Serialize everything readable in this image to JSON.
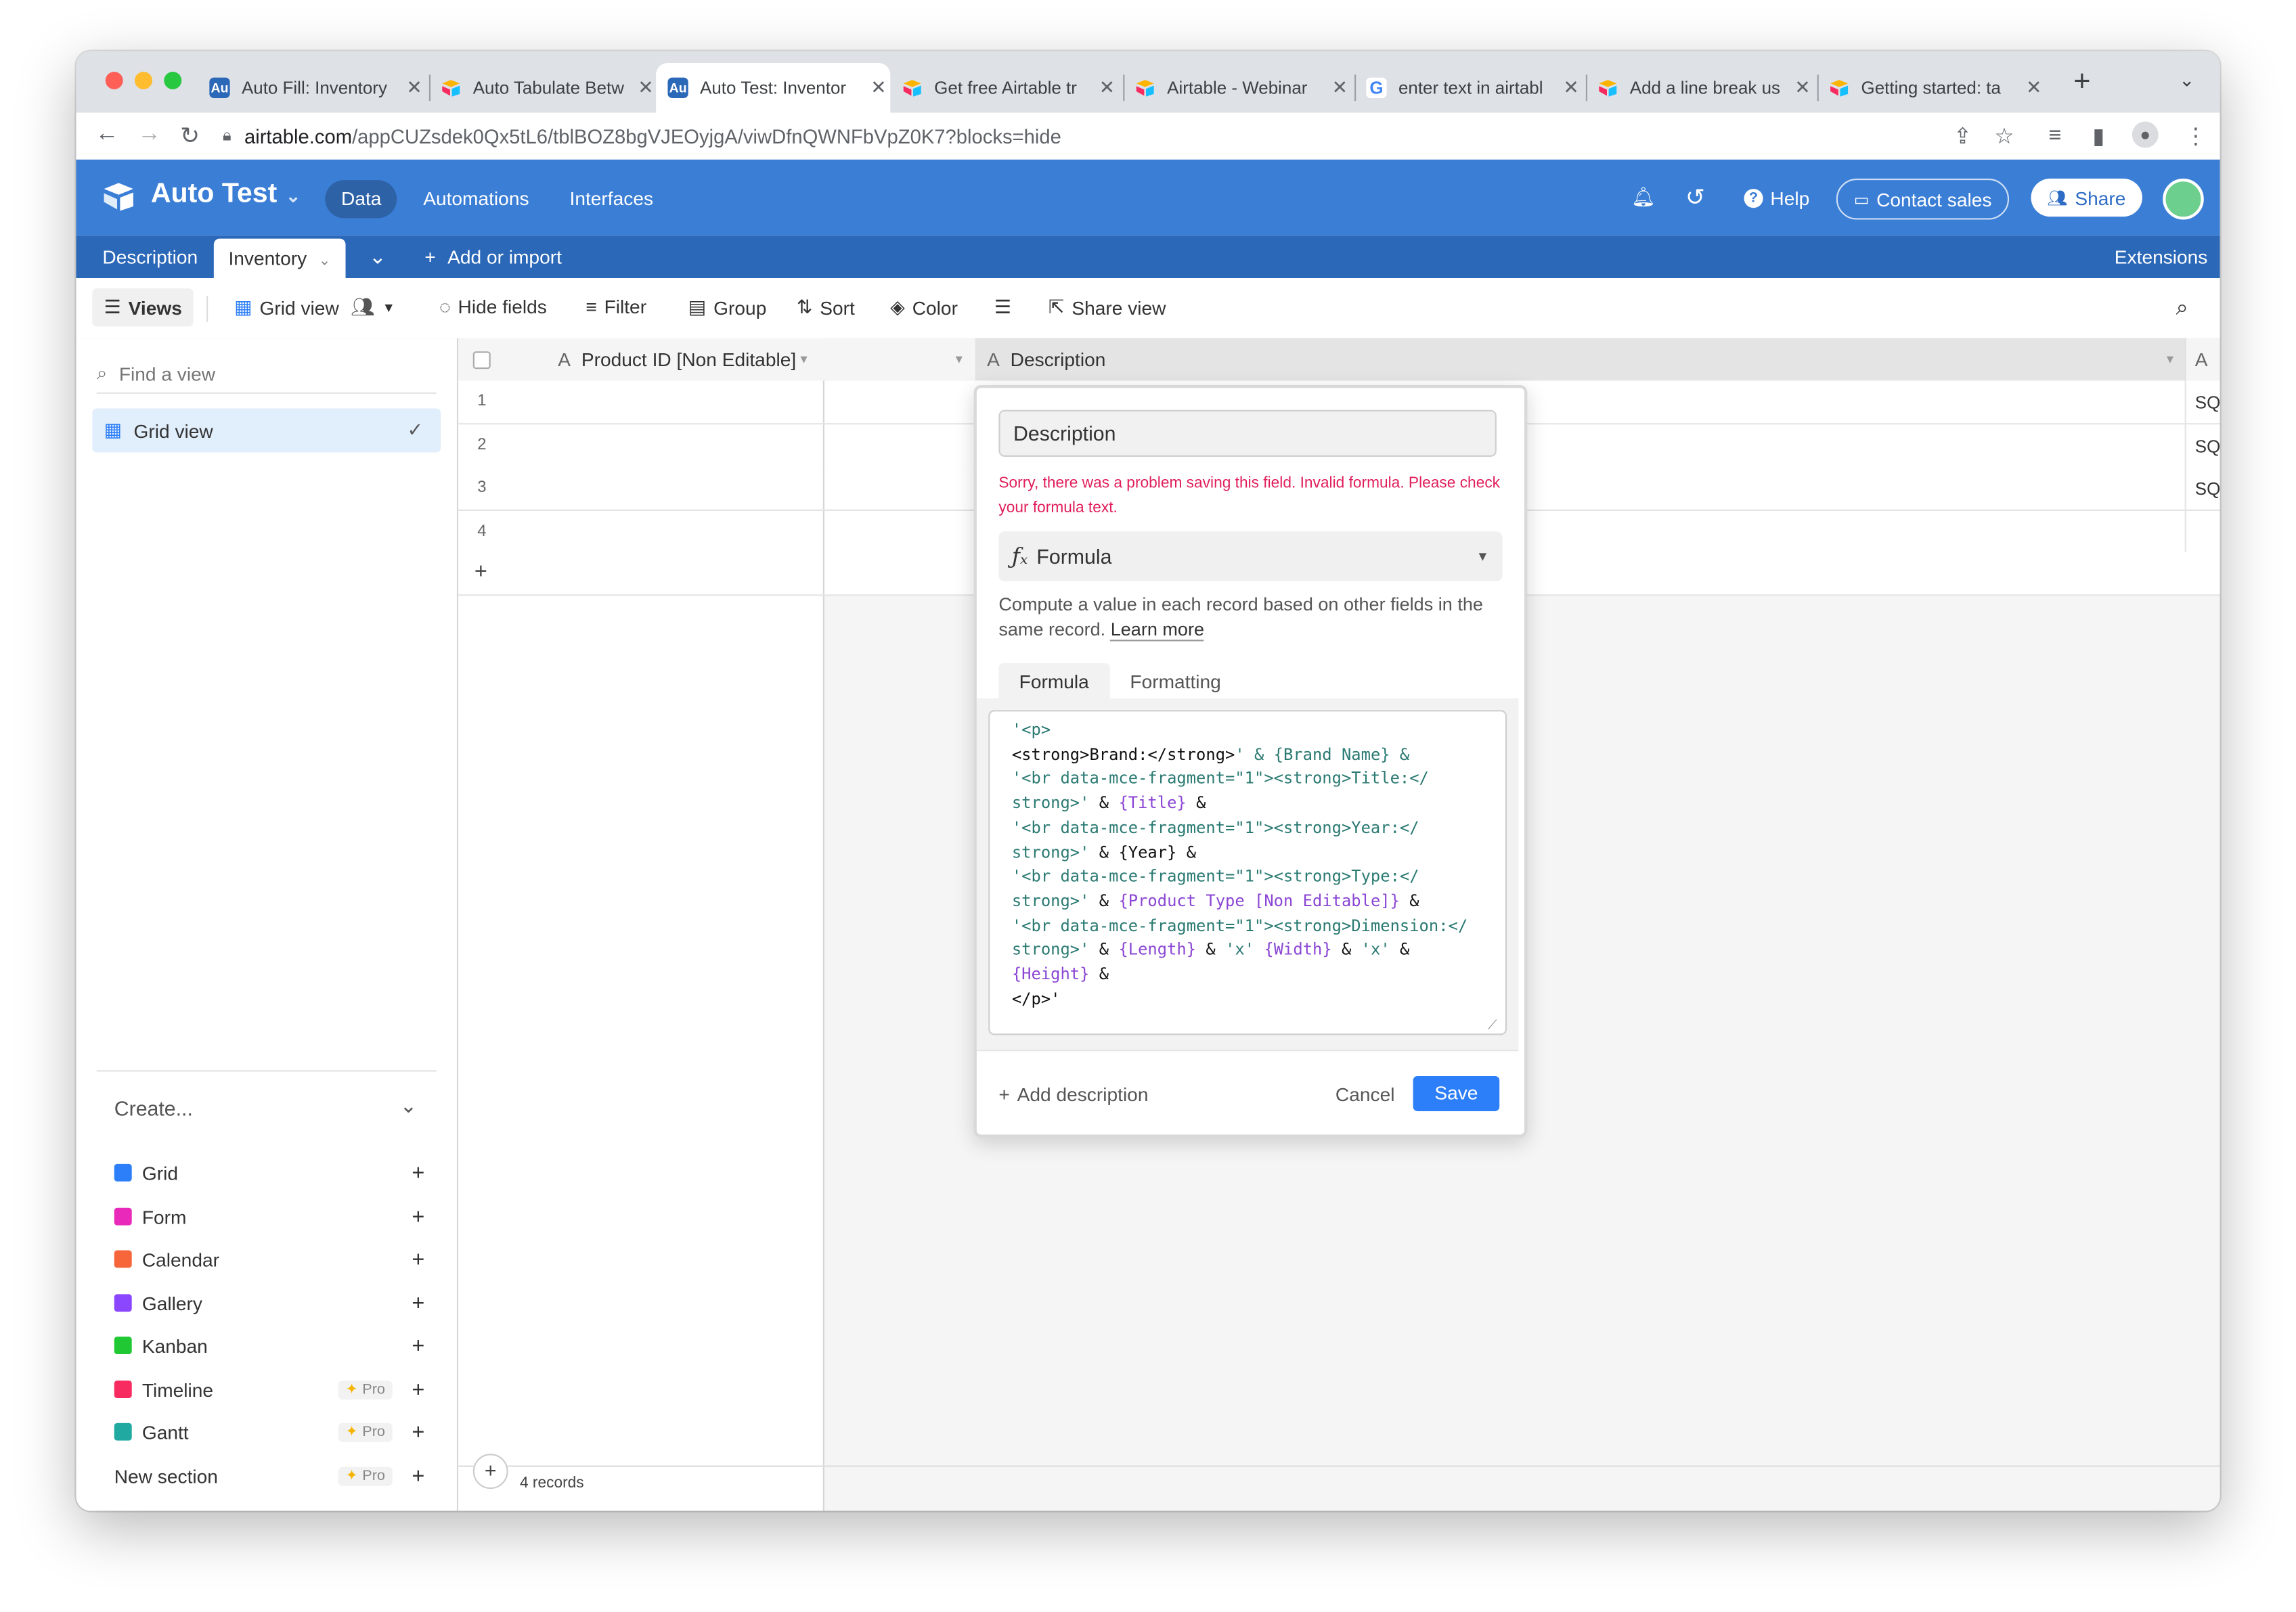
{
  "browser": {
    "tabs": [
      {
        "title": "Auto Fill: Inventory",
        "favicon": "Au"
      },
      {
        "title": "Auto Tabulate Betw",
        "favicon": "airtable"
      },
      {
        "title": "Auto Test: Inventor",
        "favicon": "Au",
        "active": true
      },
      {
        "title": "Get free Airtable tr",
        "favicon": "airtable"
      },
      {
        "title": "Airtable - Webinar",
        "favicon": "airtable"
      },
      {
        "title": "enter text in airtabl",
        "favicon": "G"
      },
      {
        "title": "Add a line break us",
        "favicon": "airtable"
      },
      {
        "title": "Getting started: ta",
        "favicon": "airtable"
      }
    ],
    "url_domain": "airtable.com",
    "url_path": "/appCUZsdek0Qx5tL6/tblBOZ8bgVJEOyjgA/viwDfnQWNFbVpZ0K7?blocks=hide"
  },
  "header": {
    "base_name": "Auto Test",
    "nav": [
      "Data",
      "Automations",
      "Interfaces"
    ],
    "help": "Help",
    "contact_sales": "Contact sales",
    "share": "Share"
  },
  "tables": {
    "items": [
      "Description",
      "Inventory"
    ],
    "add_or_import": "Add or import",
    "extensions": "Extensions"
  },
  "toolbar": {
    "views": "Views",
    "grid_view": "Grid view",
    "hide_fields": "Hide fields",
    "filter": "Filter",
    "group": "Group",
    "sort": "Sort",
    "color": "Color",
    "share_view": "Share view"
  },
  "sidebar": {
    "find_placeholder": "Find a view",
    "active_view": "Grid view",
    "create_label": "Create...",
    "create_items": [
      {
        "label": "Grid",
        "color": "#2d7ff9"
      },
      {
        "label": "Form",
        "color": "#e929ba"
      },
      {
        "label": "Calendar",
        "color": "#f7653b"
      },
      {
        "label": "Gallery",
        "color": "#8b46ff"
      },
      {
        "label": "Kanban",
        "color": "#20c933"
      },
      {
        "label": "Timeline",
        "color": "#f82b60",
        "badge": "Pro"
      },
      {
        "label": "Gantt",
        "color": "#20a9a0",
        "badge": "Pro"
      },
      {
        "label": "New section",
        "badge": "Pro"
      }
    ]
  },
  "grid": {
    "columns": [
      "Product ID [Non Editable]",
      "",
      "Description"
    ],
    "rows": [
      "1",
      "2",
      "3",
      "4"
    ],
    "right_cell_text": "SQ",
    "record_count": "4 records"
  },
  "field_editor": {
    "field_name": "Description",
    "error": "Sorry, there was a problem saving this field. Invalid formula. Please check your formula text.",
    "field_type": "Formula",
    "type_description": "Compute a value in each record based on other fields in the same record.",
    "learn_more": "Learn more",
    "tabs": [
      "Formula",
      "Formatting"
    ],
    "formula_lines": [
      [
        {
          "t": "s",
          "v": "'<p>"
        }
      ],
      [
        {
          "t": "n",
          "v": "<strong>Brand:</strong>"
        },
        {
          "t": "s",
          "v": "' & {Brand Name} &"
        }
      ],
      [
        {
          "t": "s",
          "v": "'<br data-mce-fragment=\"1\"><strong>Title:</"
        }
      ],
      [
        {
          "t": "s",
          "v": "strong>'"
        },
        {
          "t": "n",
          "v": " & "
        },
        {
          "t": "f",
          "v": "{Title}"
        },
        {
          "t": "n",
          "v": " &"
        }
      ],
      [
        {
          "t": "s",
          "v": "'<br data-mce-fragment=\"1\"><strong>Year:</"
        }
      ],
      [
        {
          "t": "s",
          "v": "strong>'"
        },
        {
          "t": "n",
          "v": " & {Year} &"
        }
      ],
      [
        {
          "t": "s",
          "v": "'<br data-mce-fragment=\"1\"><strong>Type:</"
        }
      ],
      [
        {
          "t": "s",
          "v": "strong>'"
        },
        {
          "t": "n",
          "v": " & "
        },
        {
          "t": "f",
          "v": "{Product Type [Non Editable]}"
        },
        {
          "t": "n",
          "v": " &"
        }
      ],
      [
        {
          "t": "s",
          "v": "'<br data-mce-fragment=\"1\"><strong>Dimension:</"
        }
      ],
      [
        {
          "t": "s",
          "v": "strong>'"
        },
        {
          "t": "n",
          "v": " & "
        },
        {
          "t": "f",
          "v": "{Length}"
        },
        {
          "t": "n",
          "v": " & "
        },
        {
          "t": "s",
          "v": "'x'"
        },
        {
          "t": "n",
          "v": " "
        },
        {
          "t": "f",
          "v": "{Width}"
        },
        {
          "t": "n",
          "v": " & "
        },
        {
          "t": "s",
          "v": "'x'"
        },
        {
          "t": "n",
          "v": " &"
        }
      ],
      [
        {
          "t": "f",
          "v": "{Height}"
        },
        {
          "t": "n",
          "v": " &"
        }
      ],
      [
        {
          "t": "n",
          "v": "</p>'"
        }
      ]
    ],
    "add_description": "Add description",
    "cancel": "Cancel",
    "save": "Save"
  }
}
